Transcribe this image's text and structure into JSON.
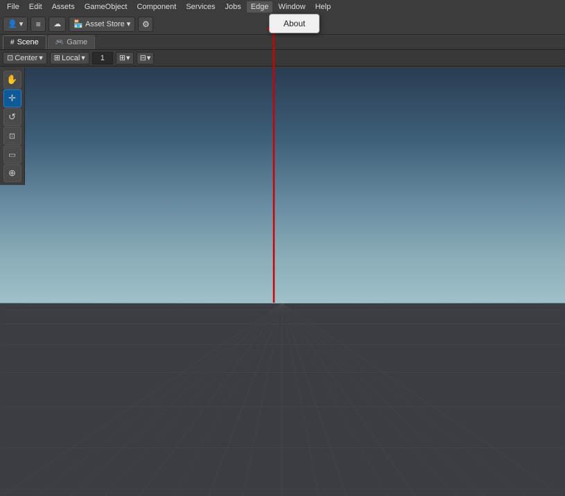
{
  "menubar": {
    "items": [
      {
        "id": "file",
        "label": "File"
      },
      {
        "id": "edit",
        "label": "Edit"
      },
      {
        "id": "assets",
        "label": "Assets"
      },
      {
        "id": "gameobject",
        "label": "GameObject"
      },
      {
        "id": "component",
        "label": "Component"
      },
      {
        "id": "services",
        "label": "Services"
      },
      {
        "id": "jobs",
        "label": "Jobs"
      },
      {
        "id": "edge",
        "label": "Edge"
      },
      {
        "id": "window",
        "label": "Window"
      },
      {
        "id": "help",
        "label": "Help"
      }
    ]
  },
  "toolbar": {
    "account_icon": "👤",
    "layers_icon": "≡",
    "cloud_icon": "☁",
    "asset_store_label": "Asset Store",
    "asset_store_dropdown": "▼",
    "settings_icon": "⚙"
  },
  "tabs": [
    {
      "id": "scene",
      "label": "Scene",
      "icon": "#",
      "active": true
    },
    {
      "id": "game",
      "label": "Game",
      "icon": "🎮",
      "active": false
    }
  ],
  "tool_options": {
    "pivot_label": "Center",
    "space_label": "Local",
    "number_value": "1",
    "grid_icon": "⊞",
    "snap_icon": "⊟"
  },
  "tools": [
    {
      "id": "hand",
      "icon": "✋",
      "active": false
    },
    {
      "id": "move",
      "icon": "✛",
      "active": true
    },
    {
      "id": "rotate",
      "icon": "↺",
      "active": false
    },
    {
      "id": "scale",
      "icon": "⊡",
      "active": false
    },
    {
      "id": "rect",
      "icon": "▭",
      "active": false
    },
    {
      "id": "transform",
      "icon": "⊕",
      "active": false
    }
  ],
  "about_dropdown": {
    "label": "About"
  },
  "arrow": {
    "color": "#cc0000"
  }
}
